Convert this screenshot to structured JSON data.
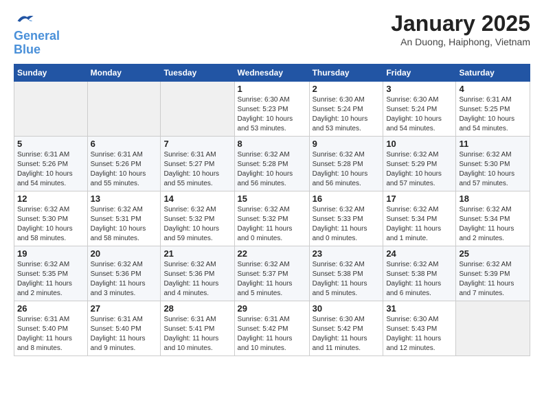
{
  "header": {
    "logo_line1": "General",
    "logo_line2": "Blue",
    "title": "January 2025",
    "subtitle": "An Duong, Haiphong, Vietnam"
  },
  "days_of_week": [
    "Sunday",
    "Monday",
    "Tuesday",
    "Wednesday",
    "Thursday",
    "Friday",
    "Saturday"
  ],
  "weeks": [
    {
      "cells": [
        {
          "day": "",
          "info": ""
        },
        {
          "day": "",
          "info": ""
        },
        {
          "day": "",
          "info": ""
        },
        {
          "day": "1",
          "info": "Sunrise: 6:30 AM\nSunset: 5:23 PM\nDaylight: 10 hours\nand 53 minutes."
        },
        {
          "day": "2",
          "info": "Sunrise: 6:30 AM\nSunset: 5:24 PM\nDaylight: 10 hours\nand 53 minutes."
        },
        {
          "day": "3",
          "info": "Sunrise: 6:30 AM\nSunset: 5:24 PM\nDaylight: 10 hours\nand 54 minutes."
        },
        {
          "day": "4",
          "info": "Sunrise: 6:31 AM\nSunset: 5:25 PM\nDaylight: 10 hours\nand 54 minutes."
        }
      ]
    },
    {
      "cells": [
        {
          "day": "5",
          "info": "Sunrise: 6:31 AM\nSunset: 5:26 PM\nDaylight: 10 hours\nand 54 minutes."
        },
        {
          "day": "6",
          "info": "Sunrise: 6:31 AM\nSunset: 5:26 PM\nDaylight: 10 hours\nand 55 minutes."
        },
        {
          "day": "7",
          "info": "Sunrise: 6:31 AM\nSunset: 5:27 PM\nDaylight: 10 hours\nand 55 minutes."
        },
        {
          "day": "8",
          "info": "Sunrise: 6:32 AM\nSunset: 5:28 PM\nDaylight: 10 hours\nand 56 minutes."
        },
        {
          "day": "9",
          "info": "Sunrise: 6:32 AM\nSunset: 5:28 PM\nDaylight: 10 hours\nand 56 minutes."
        },
        {
          "day": "10",
          "info": "Sunrise: 6:32 AM\nSunset: 5:29 PM\nDaylight: 10 hours\nand 57 minutes."
        },
        {
          "day": "11",
          "info": "Sunrise: 6:32 AM\nSunset: 5:30 PM\nDaylight: 10 hours\nand 57 minutes."
        }
      ]
    },
    {
      "cells": [
        {
          "day": "12",
          "info": "Sunrise: 6:32 AM\nSunset: 5:30 PM\nDaylight: 10 hours\nand 58 minutes."
        },
        {
          "day": "13",
          "info": "Sunrise: 6:32 AM\nSunset: 5:31 PM\nDaylight: 10 hours\nand 58 minutes."
        },
        {
          "day": "14",
          "info": "Sunrise: 6:32 AM\nSunset: 5:32 PM\nDaylight: 10 hours\nand 59 minutes."
        },
        {
          "day": "15",
          "info": "Sunrise: 6:32 AM\nSunset: 5:32 PM\nDaylight: 11 hours\nand 0 minutes."
        },
        {
          "day": "16",
          "info": "Sunrise: 6:32 AM\nSunset: 5:33 PM\nDaylight: 11 hours\nand 0 minutes."
        },
        {
          "day": "17",
          "info": "Sunrise: 6:32 AM\nSunset: 5:34 PM\nDaylight: 11 hours\nand 1 minute."
        },
        {
          "day": "18",
          "info": "Sunrise: 6:32 AM\nSunset: 5:34 PM\nDaylight: 11 hours\nand 2 minutes."
        }
      ]
    },
    {
      "cells": [
        {
          "day": "19",
          "info": "Sunrise: 6:32 AM\nSunset: 5:35 PM\nDaylight: 11 hours\nand 2 minutes."
        },
        {
          "day": "20",
          "info": "Sunrise: 6:32 AM\nSunset: 5:36 PM\nDaylight: 11 hours\nand 3 minutes."
        },
        {
          "day": "21",
          "info": "Sunrise: 6:32 AM\nSunset: 5:36 PM\nDaylight: 11 hours\nand 4 minutes."
        },
        {
          "day": "22",
          "info": "Sunrise: 6:32 AM\nSunset: 5:37 PM\nDaylight: 11 hours\nand 5 minutes."
        },
        {
          "day": "23",
          "info": "Sunrise: 6:32 AM\nSunset: 5:38 PM\nDaylight: 11 hours\nand 5 minutes."
        },
        {
          "day": "24",
          "info": "Sunrise: 6:32 AM\nSunset: 5:38 PM\nDaylight: 11 hours\nand 6 minutes."
        },
        {
          "day": "25",
          "info": "Sunrise: 6:32 AM\nSunset: 5:39 PM\nDaylight: 11 hours\nand 7 minutes."
        }
      ]
    },
    {
      "cells": [
        {
          "day": "26",
          "info": "Sunrise: 6:31 AM\nSunset: 5:40 PM\nDaylight: 11 hours\nand 8 minutes."
        },
        {
          "day": "27",
          "info": "Sunrise: 6:31 AM\nSunset: 5:40 PM\nDaylight: 11 hours\nand 9 minutes."
        },
        {
          "day": "28",
          "info": "Sunrise: 6:31 AM\nSunset: 5:41 PM\nDaylight: 11 hours\nand 10 minutes."
        },
        {
          "day": "29",
          "info": "Sunrise: 6:31 AM\nSunset: 5:42 PM\nDaylight: 11 hours\nand 10 minutes."
        },
        {
          "day": "30",
          "info": "Sunrise: 6:30 AM\nSunset: 5:42 PM\nDaylight: 11 hours\nand 11 minutes."
        },
        {
          "day": "31",
          "info": "Sunrise: 6:30 AM\nSunset: 5:43 PM\nDaylight: 11 hours\nand 12 minutes."
        },
        {
          "day": "",
          "info": ""
        }
      ]
    }
  ]
}
